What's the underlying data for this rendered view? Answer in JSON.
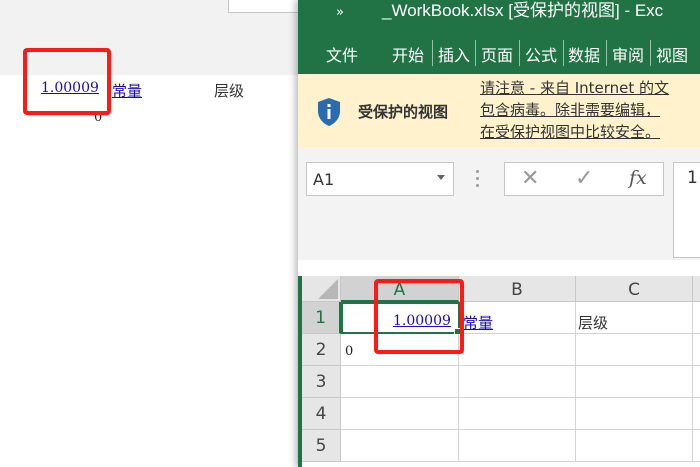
{
  "background_doc": {
    "link_value": "1.00009",
    "constant_label": "常量",
    "level_label": "层级",
    "zero_value": "0"
  },
  "excel": {
    "title": "_WorkBook.xlsx  [受保护的视图]  -  Exc",
    "qat_glyph": "»",
    "tabs": [
      "文件",
      "开始",
      "插入",
      "页面",
      "公式",
      "数据",
      "审阅",
      "视图"
    ],
    "protected_bar": {
      "title": "受保护的视图",
      "message_line1": "请注意 - 来自 Internet 的文",
      "message_line2": "包含病毒。除非需要编辑，",
      "message_line3": "在受保护视图中比较安全。"
    },
    "formula_bar": {
      "name_box": "A1",
      "cancel_glyph": "✕",
      "enter_glyph": "✓",
      "fx_label": "fx",
      "value_visible": "1"
    },
    "columns": [
      "A",
      "B",
      "C"
    ],
    "rows": [
      "1",
      "2",
      "3",
      "4",
      "5"
    ],
    "cells": {
      "A1": "1.00009",
      "B1": "常量",
      "C1": "层级",
      "A2": "0"
    }
  },
  "colors": {
    "excel_green": "#217346",
    "highlight_red": "#ff1a1a",
    "protected_bar_bg": "#fff2cc",
    "link_blue": "#1a0dab"
  },
  "icons": [
    "shield-info-icon",
    "dropdown-arrow-icon",
    "cancel-icon",
    "enter-icon",
    "function-icon",
    "select-all-icon"
  ]
}
